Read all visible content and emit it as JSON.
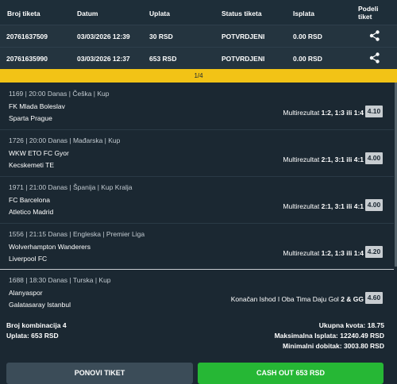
{
  "header": {
    "ticket_id": "Broj tiketa",
    "date": "Datum",
    "stake": "Uplata",
    "status": "Status tiketa",
    "payout": "Isplata",
    "share_line1": "Podeli",
    "share_line2": "tiket"
  },
  "tickets": [
    {
      "id": "20761637509",
      "date": "03/03/2026 12:39",
      "stake": "30 RSD",
      "status": "POTVRDJENI",
      "payout": "0.00 RSD",
      "share_icon": "share-icon"
    },
    {
      "id": "20761635990",
      "date": "03/03/2026 12:37",
      "stake": "653 RSD",
      "status": "POTVRDJENI",
      "payout": "0.00 RSD",
      "share_icon": "share-icon"
    }
  ],
  "pager": "1/4",
  "bets": [
    {
      "meta": "1169 | 20:00 Danas | Češka | Kup",
      "team1": "FK Mlada Boleslav",
      "team2": "Sparta Prague",
      "pick_prefix": "Multirezultat ",
      "pick_value": "1:2, 1:3 ili 1:4",
      "odd": "4.10"
    },
    {
      "meta": "1726 | 20:00 Danas | Mađarska | Kup",
      "team1": "WKW ETO FC Gyor",
      "team2": "Kecskemeti TE",
      "pick_prefix": "Multirezultat ",
      "pick_value": "2:1, 3:1 ili 4:1",
      "odd": "4.00"
    },
    {
      "meta": "1971 | 21:00 Danas | Španija | Kup Kralja",
      "team1": "FC Barcelona",
      "team2": "Atletico Madrid",
      "pick_prefix": "Multirezultat ",
      "pick_value": "2:1, 3:1 ili 4:1",
      "odd": "4.00"
    },
    {
      "meta": "1556 | 21:15 Danas | Engleska | Premier Liga",
      "team1": "Wolverhampton Wanderers",
      "team2": "Liverpool FC",
      "pick_prefix": "Multirezultat ",
      "pick_value": "1:2, 1:3 ili 1:4",
      "odd": "4.20"
    },
    {
      "meta": "1688 | 18:30 Danas | Turska | Kup",
      "team1": "Alanyaspor",
      "team2": "Galatasaray Istanbul",
      "pick_prefix": "Konačan Ishod I Oba Tima Daju Gol ",
      "pick_value": "2 & GG",
      "odd": "4.60"
    }
  ],
  "summary": {
    "combinations": "Broj kombinacija 4",
    "stake": "Uplata: 653 RSD",
    "total_odds": "Ukupna kvota: 18.75",
    "max_payout": "Maksimalna Isplata: 12240.49 RSD",
    "min_win": "Minimalni dobitak: 3003.80 RSD"
  },
  "buttons": {
    "repeat": "PONOVI TIKET",
    "cashout": "CASH OUT 653 RSD"
  },
  "colors": {
    "background": "#1b2832",
    "pager": "#f2c316",
    "cashout": "#26b735",
    "repeat": "#3b4c58"
  }
}
